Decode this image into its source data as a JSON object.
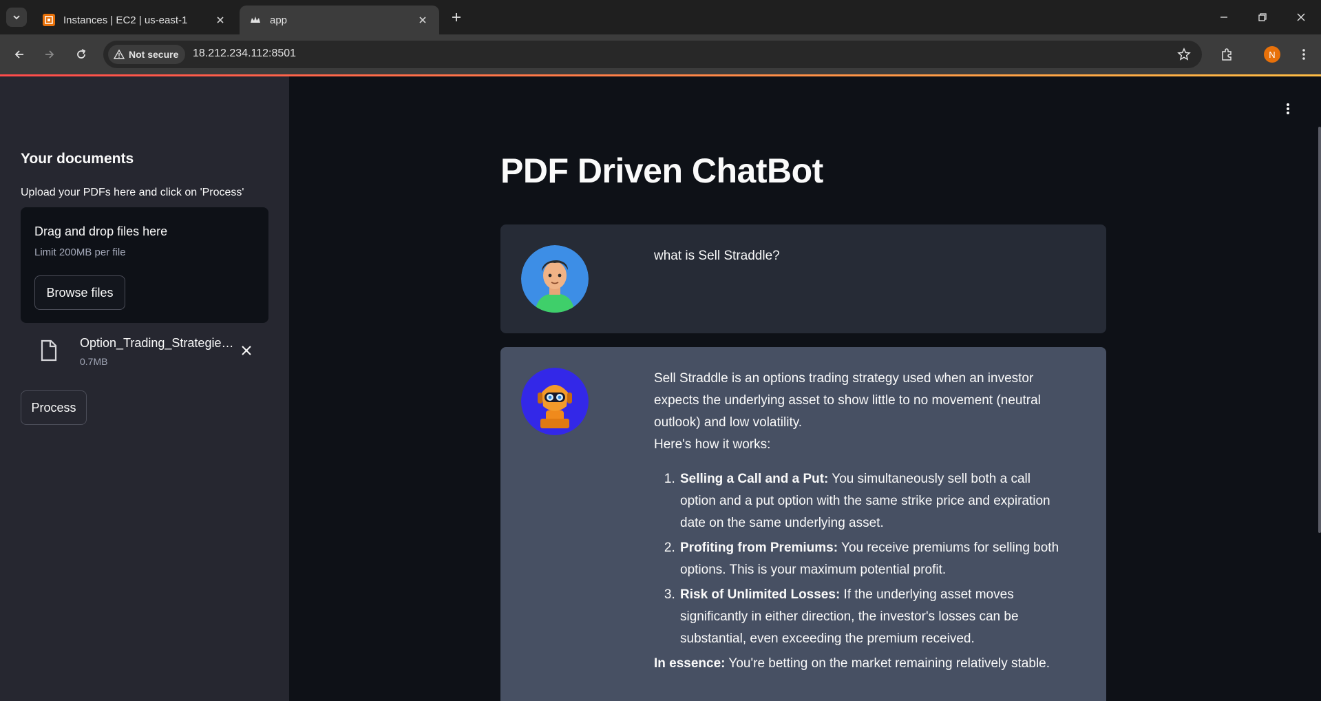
{
  "browser": {
    "tabs": [
      {
        "title": "Instances | EC2 | us-east-1",
        "active": false
      },
      {
        "title": "app",
        "active": true
      }
    ],
    "security_label": "Not secure",
    "url": "18.212.234.112:8501",
    "profile_initial": "N"
  },
  "sidebar": {
    "heading": "Your documents",
    "upload_label": "Upload your PDFs here and click on 'Process'",
    "dropzone": {
      "title": "Drag and drop files here",
      "limit": "Limit 200MB per file",
      "browse_label": "Browse files"
    },
    "files": [
      {
        "name": "Option_Trading_Strategies.pdf",
        "size": "0.7MB"
      }
    ],
    "process_label": "Process"
  },
  "main": {
    "title": "PDF Driven ChatBot",
    "messages": [
      {
        "role": "user",
        "text": "what is Sell Straddle?"
      },
      {
        "role": "bot",
        "intro": "Sell Straddle is an options trading strategy used when an investor expects the underlying asset to show little to no movement (neutral outlook) and low volatility.",
        "lead": "Here's how it works:",
        "steps": [
          {
            "title": "Selling a Call and a Put:",
            "text": " You simultaneously sell both a call option and a put option with the same strike price and expiration date on the same underlying asset."
          },
          {
            "title": "Profiting from Premiums:",
            "text": " You receive premiums for selling both options. This is your maximum potential profit."
          },
          {
            "title": "Risk of Unlimited Losses:",
            "text": " If the underlying asset moves significantly in either direction, the investor's losses can be substantial, even exceeding the premium received."
          }
        ],
        "essence_title": "In essence:",
        "essence_text": " You're betting on the market remaining relatively stable."
      }
    ]
  },
  "colors": {
    "accent_start": "#ff4b4b",
    "accent_end": "#ffbd45",
    "sidebar_bg": "#262730",
    "main_bg": "#0e1117",
    "user_msg_bg": "#262b36",
    "bot_msg_bg": "#475063"
  }
}
